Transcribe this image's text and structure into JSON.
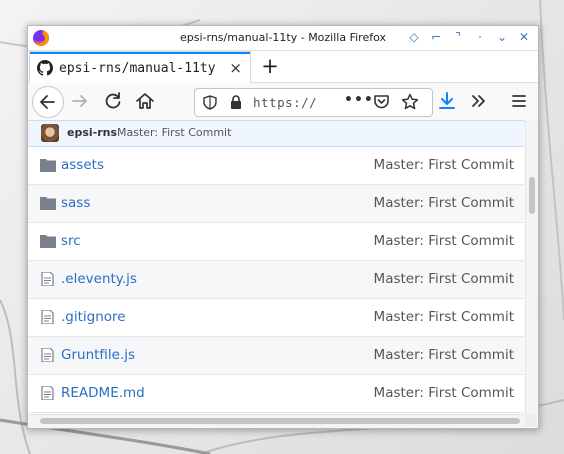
{
  "window": {
    "title": "epsi-rns/manual-11ty - Mozilla Firefox"
  },
  "tab": {
    "label": "epsi-rns/manual-11ty",
    "close_glyph": "×",
    "new_tab_glyph": "+"
  },
  "navbar": {
    "url_text": "https://",
    "url_more": "•••",
    "icons": [
      "back-arrow-icon",
      "forward-arrow-icon",
      "reload-icon",
      "home-icon",
      "shield-icon",
      "lock-icon",
      "pocket-icon",
      "bookmark-star-icon",
      "download-icon",
      "overflow-chevrons-icon",
      "hamburger-menu-icon"
    ]
  },
  "commit": {
    "author": "epsi-rns",
    "message": "Master: First Commit"
  },
  "files": [
    {
      "name": "assets",
      "type": "folder",
      "commit": "Master: First Commit"
    },
    {
      "name": "sass",
      "type": "folder",
      "commit": "Master: First Commit"
    },
    {
      "name": "src",
      "type": "folder",
      "commit": "Master: First Commit"
    },
    {
      "name": ".eleventy.js",
      "type": "file",
      "commit": "Master: First Commit"
    },
    {
      "name": ".gitignore",
      "type": "file",
      "commit": "Master: First Commit"
    },
    {
      "name": "Gruntfile.js",
      "type": "file",
      "commit": "Master: First Commit"
    },
    {
      "name": "README.md",
      "type": "file",
      "commit": "Master: First Commit"
    }
  ],
  "colors": {
    "link": "#2a6ec4",
    "accent": "#0a84ff",
    "download": "#0a84ff"
  }
}
